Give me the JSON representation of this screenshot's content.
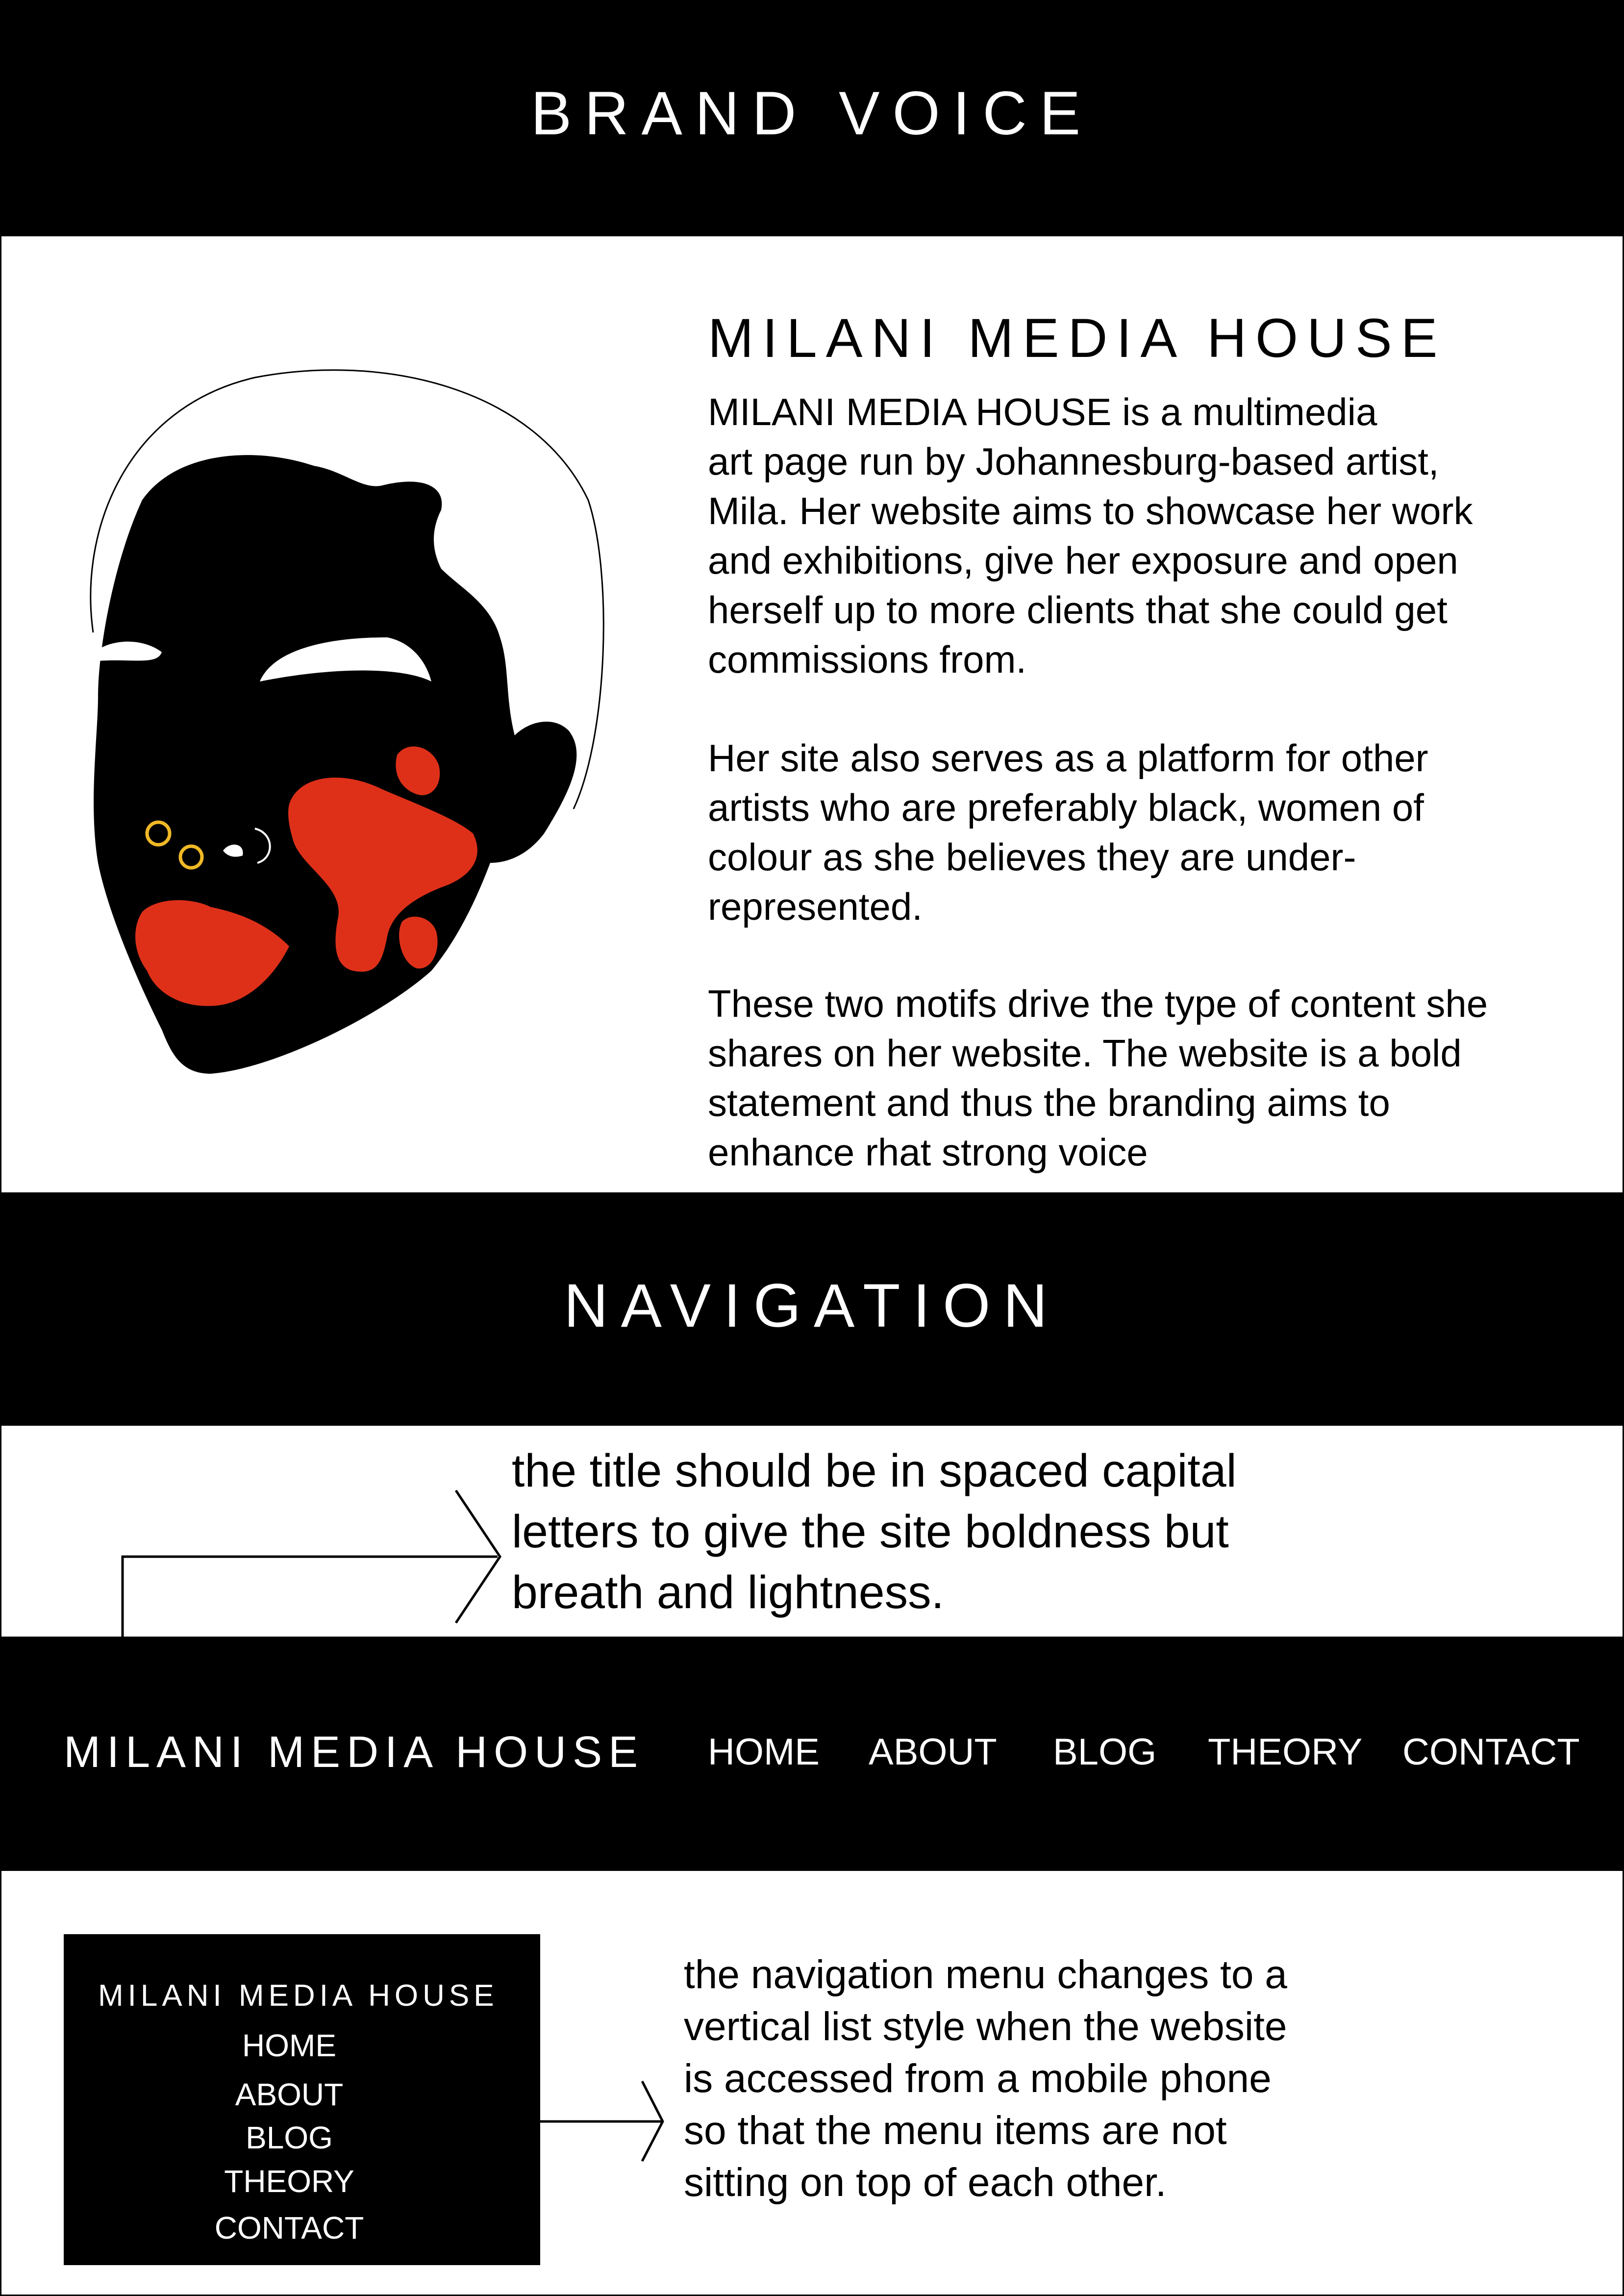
{
  "brand_voice": {
    "title": "BRAND VOICE",
    "heading": "MILANI MEDIA HOUSE",
    "paragraphs": [
      "MILANI MEDIA HOUSE is a multimedia\nart page run by Johannesburg-based artist,\nMila. Her website aims to showcase her work\nand exhibitions, give her exposure and open\nherself up to more clients that she could get\ncommissions from.",
      "Her site also serves as a platform for other\nartists who are preferably black, women of\ncolour as she believes they are under-\nrepresented.",
      "These two motifs drive the type of content she\nshares on her website. The website is a bold\nstatement and thus the branding aims to\nenhance rhat strong voice"
    ]
  },
  "navigation": {
    "title": "NAVIGATION",
    "title_note": "the title should be in spaced capital\nletters to give the site boldness but\nbreath and lightness.",
    "desktop_nav": {
      "brand": "MILANI MEDIA HOUSE",
      "items": [
        "HOME",
        "ABOUT",
        "BLOG",
        "THEORY",
        "CONTACT"
      ]
    },
    "mobile_nav": {
      "brand": "MILANI MEDIA HOUSE",
      "items": [
        "HOME",
        "ABOUT",
        "BLOG",
        "THEORY",
        "CONTACT"
      ]
    },
    "mobile_note": "the navigation menu changes to a\nvertical list style when the website\nis accessed from a mobile phone\nso that the menu items are not\nsitting on top of each other."
  },
  "colors": {
    "band": "#000000",
    "text_on_band": "#ffffff",
    "accent_red": "#de3019",
    "ring_gold": "#f0b826"
  },
  "icons": {
    "portrait": "face-illustration",
    "title_note_arrow": "chevron-arrow-icon",
    "mobile_note_arrow": "chevron-arrow-icon"
  }
}
